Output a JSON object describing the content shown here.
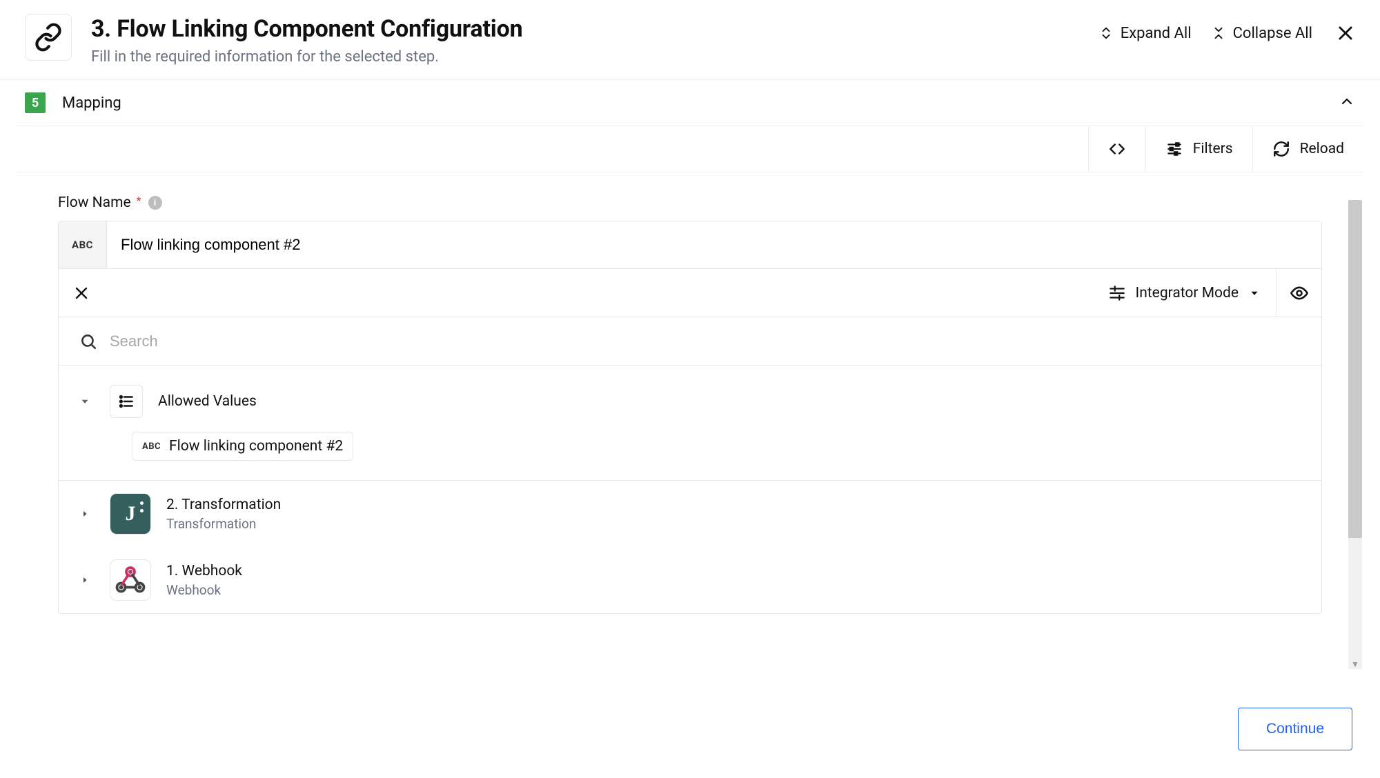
{
  "header": {
    "title": "3. Flow Linking Component Configuration",
    "subtitle": "Fill in the required information for the selected step.",
    "expand_label": "Expand All",
    "collapse_label": "Collapse All"
  },
  "section": {
    "step_number": "5",
    "title": "Mapping"
  },
  "toolbar": {
    "filters_label": "Filters",
    "reload_label": "Reload"
  },
  "field": {
    "label": "Flow Name",
    "abc": "ABC",
    "value": "Flow linking component #2"
  },
  "mode": {
    "label": "Integrator Mode"
  },
  "search": {
    "placeholder": "Search"
  },
  "allowed": {
    "title": "Allowed Values",
    "chip_abc": "ABC",
    "chip_value": "Flow linking component #2"
  },
  "nodes": [
    {
      "title": "2. Transformation",
      "subtitle": "Transformation"
    },
    {
      "title": "1. Webhook",
      "subtitle": "Webhook"
    }
  ],
  "footer": {
    "continue_label": "Continue"
  }
}
